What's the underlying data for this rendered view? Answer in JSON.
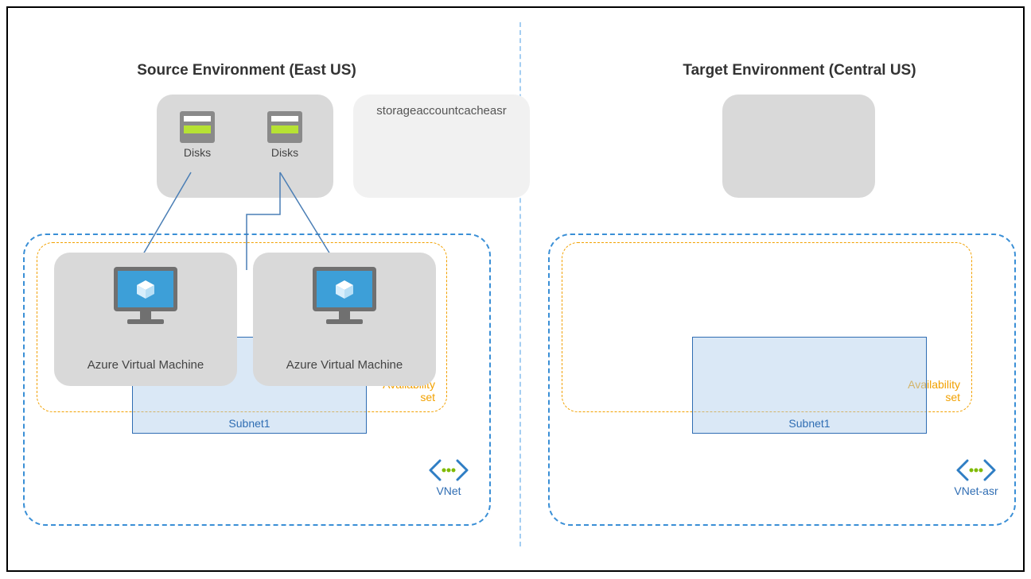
{
  "source": {
    "title": "Source Environment (East US)",
    "disks_label": "Disks",
    "storage_label": "storageaccountcacheasr",
    "vm_label": "Azure Virtual Machine",
    "avset_label": "Availability\nset",
    "subnet_label": "Subnet1",
    "vnet_label": "VNet"
  },
  "target": {
    "title": "Target Environment (Central US)",
    "avset_label": "Availability\nset",
    "subnet_label": "Subnet1",
    "vnet_label": "VNet-asr"
  }
}
